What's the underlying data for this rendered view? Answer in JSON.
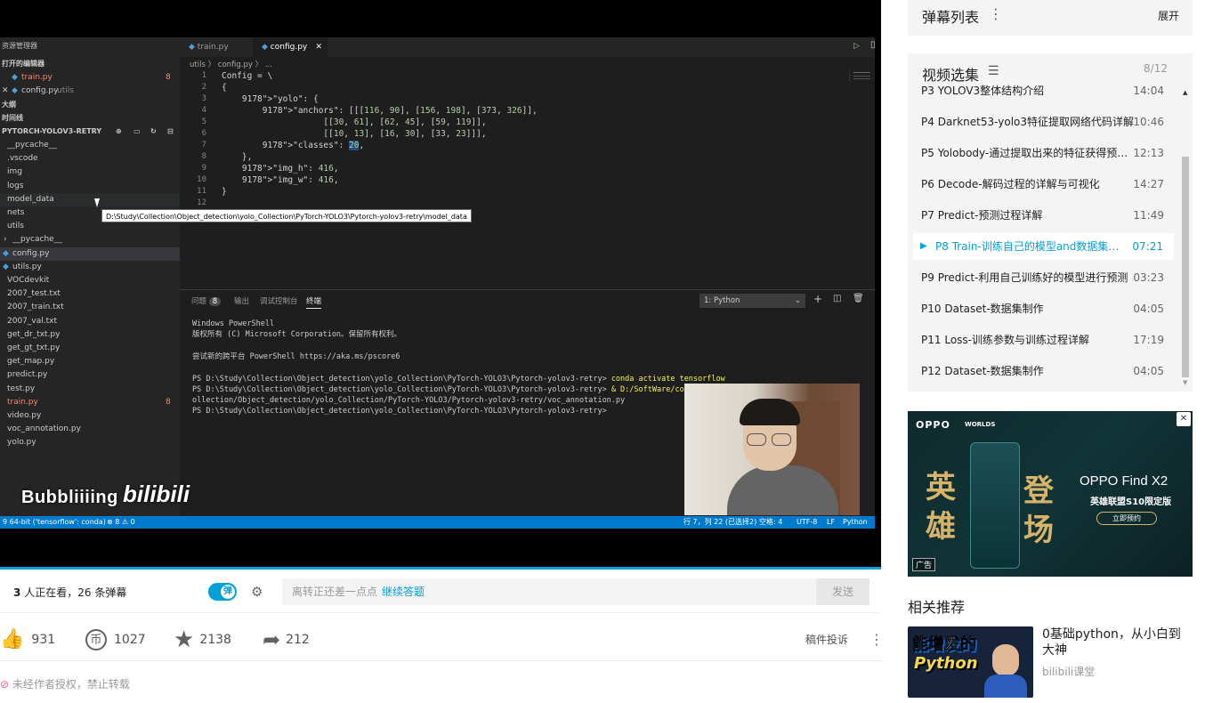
{
  "vscode": {
    "explorer_header": "资源管理器",
    "open_editors": "打开的编辑器",
    "open_files": [
      {
        "name": "train.py",
        "badge": "8"
      },
      {
        "name": "config.py",
        "suffix": "utils"
      }
    ],
    "outline": "大纲",
    "timeline": "时间线",
    "project": "PYTORCH-YOLOV3-RETRY",
    "tree": [
      "__pycache__",
      ".vscode",
      "img",
      "logs",
      "model_data",
      "nets",
      "utils",
      "__pycache__",
      "config.py",
      "utils.py",
      "VOCdevkit",
      "2007_test.txt",
      "2007_train.txt",
      "2007_val.txt",
      "get_dr_txt.py",
      "get_gt_txt.py",
      "get_map.py",
      "predict.py",
      "test.py",
      "train.py",
      "video.py",
      "voc_annotation.py",
      "yolo.py"
    ],
    "tree_badge": "8",
    "tooltip": "D:\\Study\\Collection\\Object_detection\\yolo_Collection\\PyTorch-YOLO3\\Pytorch-yolov3-retry\\model_data",
    "tabs": [
      "train.py",
      "config.py"
    ],
    "breadcrumb": "utils 〉 config.py 〉 ...",
    "code": [
      "Config = \\",
      "{",
      "    \"yolo\": {",
      "        \"anchors\": [[[116, 90], [156, 198], [373, 326]],",
      "                    [[30, 61], [62, 45], [59, 119]],",
      "                    [[10, 13], [16, 30], [33, 23]]],",
      "        \"classes\": 20,",
      "    },",
      "    \"img_h\": 416,",
      "    \"img_w\": 416,",
      "}",
      ""
    ],
    "panel_tabs": [
      "问题",
      "输出",
      "调试控制台",
      "终端"
    ],
    "problems_count": "8",
    "terminal_select": "1: Python",
    "terminal": [
      "Windows PowerShell",
      "版权所有 (C) Microsoft Corporation。保留所有权利。",
      "",
      "尝试新的跨平台 PowerShell https://aka.ms/pscore6",
      "",
      "PS D:\\Study\\Collection\\Object_detection\\yolo_Collection\\PyTorch-YOLO3\\Pytorch-yolov3-retry> conda activate tensorflow",
      "PS D:\\Study\\Collection\\Object_detection\\yolo_Collection\\PyTorch-YOLO3\\Pytorch-yolov3-retry> & D:/SoftWare/cond",
      "ollection/Object_detection/yolo_Collection/PyTorch-YOLO3/Pytorch-yolov3-retry/voc_annotation.py",
      "PS D:\\Study\\Collection\\Object_detection\\yolo_Collection\\PyTorch-YOLO3\\Pytorch-yolov3-retry>"
    ],
    "status_left": "9 64-bit ('tensorflow': conda)",
    "status_errors": "⊗ 8 ⚠ 0",
    "status_right": [
      "行 7，列 22 (已选择2)",
      "空格: 4",
      "UTF-8",
      "LF",
      "Python"
    ]
  },
  "watermark": "Bubbliiiing",
  "watermark_logo": "bilibili",
  "toolbar": {
    "viewers": "3",
    "viewers_text": "人正在看，",
    "danmaku": "26",
    "danmaku_text": "条弹幕",
    "danmaku_toggle": "弹",
    "placeholder": "离转正还差一点点",
    "link": "继续答题",
    "send": "发送"
  },
  "actions": {
    "like": "931",
    "coin": "1027",
    "fav": "2138",
    "share": "212",
    "report": "稿件投诉"
  },
  "notice": "未经作者授权，禁止转载",
  "sidebar": {
    "danmaku_title": "弹幕列表",
    "expand": "展开",
    "playlist_title": "视频选集",
    "count": "8/12",
    "episodes": [
      {
        "p": "P3",
        "name": "YOLOV3整体结构介绍",
        "dur": "14:04"
      },
      {
        "p": "P4",
        "name": "Darknet53-yolo3特征提取网络代码详解",
        "dur": "10:46"
      },
      {
        "p": "P5",
        "name": "Yolobody-通过提取出来的特征获得预测结果",
        "dur": "12:13"
      },
      {
        "p": "P6",
        "name": "Decode-解码过程的详解与可视化",
        "dur": "14:27"
      },
      {
        "p": "P7",
        "name": "Predict-预测过程详解",
        "dur": "11:49"
      },
      {
        "p": "P8",
        "name": "Train-训练自己的模型and数据集格式",
        "dur": "07:21",
        "active": true
      },
      {
        "p": "P9",
        "name": "Predict-利用自己训练好的模型进行预测",
        "dur": "03:23"
      },
      {
        "p": "P10",
        "name": "Dataset-数据集制作",
        "dur": "04:05"
      },
      {
        "p": "P11",
        "name": "Loss-训练参数与训练过程详解",
        "dur": "17:19"
      },
      {
        "p": "P12",
        "name": "Dataset-数据集制作",
        "dur": "04:05"
      }
    ],
    "ad": {
      "brand": "OPPO",
      "worlds": "WORLDS",
      "product": "OPPO Find X2",
      "edition": "英雄联盟S10限定版",
      "cta": "立即预约",
      "big_chars": [
        "英",
        "雄",
        "登",
        "场"
      ],
      "ad_label": "广告",
      "close": "✕"
    },
    "related_title": "相关推荐",
    "related": {
      "thumb_text1": "能增发的",
      "thumb_text2": "Python",
      "title": "0基础python，从小白到大神",
      "author": "bilibili课堂"
    }
  },
  "colors": {
    "accent": "#00a1d6",
    "vscode_blue": "#007acc",
    "string": "#ce9178",
    "key": "#ce9178"
  }
}
